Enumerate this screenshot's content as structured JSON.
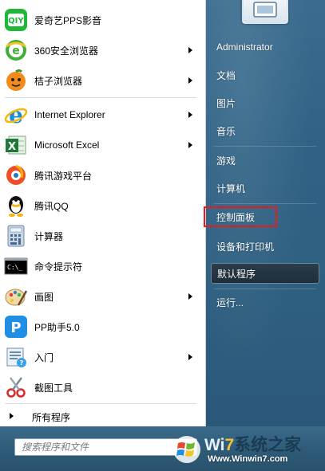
{
  "programs": {
    "pinned": [
      {
        "label": "爱奇艺PPS影音",
        "icon": "iqiyi-icon",
        "has_submenu": false
      },
      {
        "label": "360安全浏览器",
        "icon": "360-browser-icon",
        "has_submenu": true
      },
      {
        "label": "桔子浏览器",
        "icon": "orange-browser-icon",
        "has_submenu": true
      }
    ],
    "recent": [
      {
        "label": "Internet Explorer",
        "icon": "internet-explorer-icon",
        "has_submenu": true
      },
      {
        "label": "Microsoft Excel",
        "icon": "excel-icon",
        "has_submenu": true
      },
      {
        "label": "腾讯游戏平台",
        "icon": "tencent-games-icon",
        "has_submenu": false
      },
      {
        "label": "腾讯QQ",
        "icon": "qq-icon",
        "has_submenu": false
      },
      {
        "label": "计算器",
        "icon": "calculator-icon",
        "has_submenu": false
      },
      {
        "label": "命令提示符",
        "icon": "command-prompt-icon",
        "has_submenu": false
      },
      {
        "label": "画图",
        "icon": "paint-icon",
        "has_submenu": true
      },
      {
        "label": "PP助手5.0",
        "icon": "pp-assistant-icon",
        "has_submenu": false
      },
      {
        "label": "入门",
        "icon": "getting-started-icon",
        "has_submenu": true
      },
      {
        "label": "截图工具",
        "icon": "snipping-tool-icon",
        "has_submenu": false
      }
    ],
    "all_programs_label": "所有程序"
  },
  "search": {
    "placeholder": "搜索程序和文件",
    "value": ""
  },
  "right_panel": {
    "items": [
      {
        "label": "Administrator",
        "name": "right-item-administrator"
      },
      {
        "label": "文档",
        "name": "right-item-documents"
      },
      {
        "label": "图片",
        "name": "right-item-pictures"
      },
      {
        "label": "音乐",
        "name": "right-item-music"
      },
      {
        "label": "游戏",
        "name": "right-item-games"
      },
      {
        "label": "计算机",
        "name": "right-item-computer"
      },
      {
        "label": "控制面板",
        "name": "right-item-control-panel"
      },
      {
        "label": "设备和打印机",
        "name": "right-item-devices-printers"
      },
      {
        "label": "默认程序",
        "name": "right-item-default-programs"
      },
      {
        "label": "运行...",
        "name": "right-item-run"
      }
    ],
    "highlighted": "控制面板",
    "active": "默认程序"
  },
  "watermark": {
    "text_win": "Wi",
    "text_7": "7",
    "text_rest": "系统之家",
    "url": "Www.Winwin7.com"
  },
  "colors": {
    "right_panel": "#2f6285",
    "highlight_border": "#e31c1c",
    "watermark_accent": "#f7c234"
  }
}
